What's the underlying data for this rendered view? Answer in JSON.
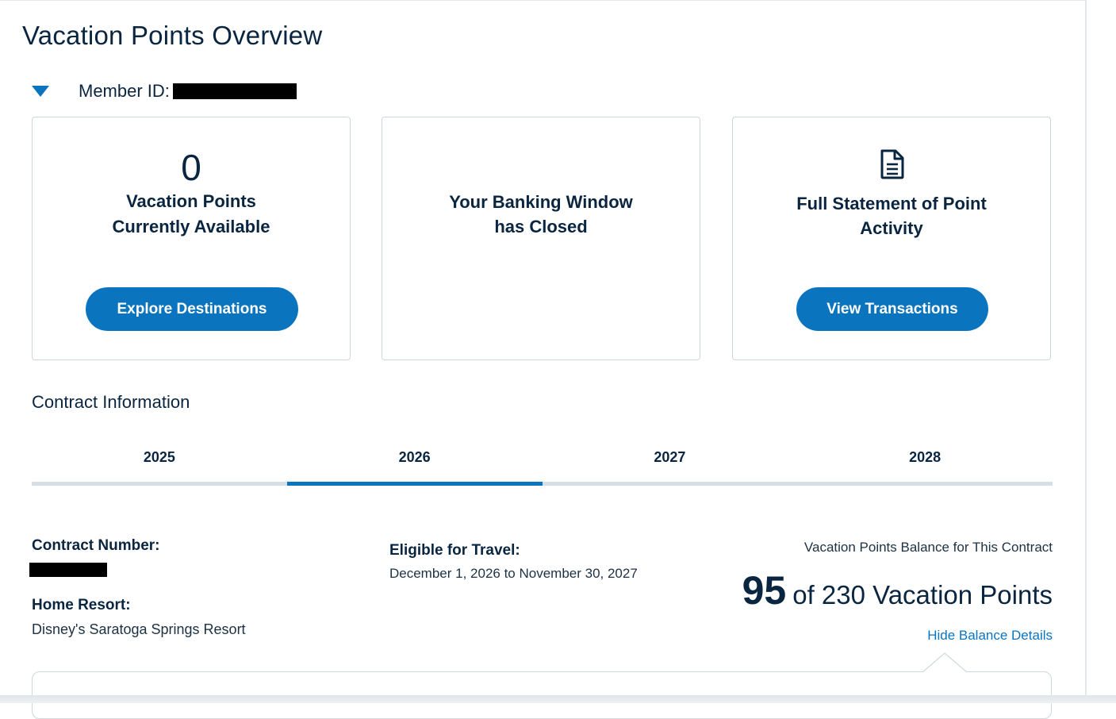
{
  "page": {
    "title": "Vacation Points Overview"
  },
  "member": {
    "label": "Member ID:"
  },
  "cards": {
    "points": {
      "value": "0",
      "line1": "Vacation Points",
      "line2": "Currently Available",
      "button": "Explore Destinations"
    },
    "banking": {
      "line1": "Your Banking Window",
      "line2": "has Closed"
    },
    "statement": {
      "icon": "document-icon",
      "line1": "Full Statement of Point",
      "line2": "Activity",
      "button": "View Transactions"
    }
  },
  "contract": {
    "section_title": "Contract Information",
    "tabs": [
      {
        "label": "2025",
        "active": false
      },
      {
        "label": "2026",
        "active": true
      },
      {
        "label": "2027",
        "active": false
      },
      {
        "label": "2028",
        "active": false
      }
    ],
    "number_label": "Contract Number:",
    "home_resort_label": "Home Resort:",
    "home_resort": "Disney's Saratoga Springs Resort",
    "eligible_label": "Eligible for Travel:",
    "eligible_range": "December 1, 2026 to November 30, 2027",
    "balance_caption": "Vacation Points Balance for This Contract",
    "balance_value": "95",
    "balance_total_text": "of 230 Vacation Points",
    "hide_link": "Hide Balance Details"
  },
  "colors": {
    "accent": "#0b74bf",
    "text": "#0a2540",
    "border": "#cfd6dc"
  }
}
